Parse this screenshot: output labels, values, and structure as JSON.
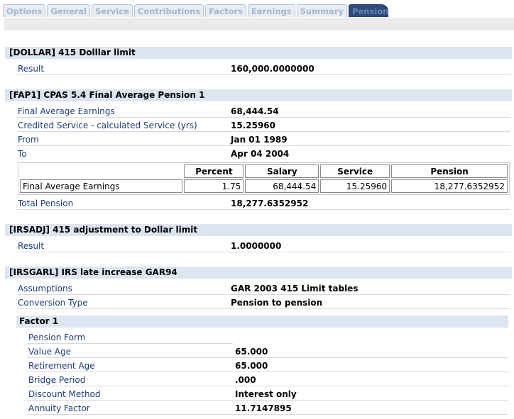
{
  "tabs": [
    {
      "label": "Options"
    },
    {
      "label": "General"
    },
    {
      "label": "Service"
    },
    {
      "label": "Contributions"
    },
    {
      "label": "Factors"
    },
    {
      "label": "Earnings"
    },
    {
      "label": "Summary"
    },
    {
      "label": "Pension",
      "active": true
    }
  ],
  "sections": {
    "dollar": {
      "title": "[DOLLAR] 415 Dolllar limit",
      "rows": [
        {
          "label": "Result",
          "value": "160,000.0000000"
        }
      ]
    },
    "fap1": {
      "title": "[FAP1] CPAS 5.4 Final Average Pension 1",
      "rows": [
        {
          "label": "Final Average Earnings",
          "value": "68,444.54"
        },
        {
          "label": "Credited Service - calculated Service (yrs)",
          "value": "15.25960"
        },
        {
          "label": "From",
          "value": "Jan 01 1989"
        },
        {
          "label": "To",
          "value": "Apr 04 2004"
        }
      ],
      "table": {
        "headers": [
          "Percent",
          "Salary",
          "Service",
          "Pension"
        ],
        "row": {
          "label": "Final Average Earnings",
          "percent": "1.75",
          "salary": "68,444.54",
          "service": "15.25960",
          "pension": "18,277.6352952"
        }
      },
      "total": {
        "label": "Total Pension",
        "value": "18,277.6352952"
      }
    },
    "irsadj": {
      "title": "[IRSADJ] 415 adjustment to Dollar limit",
      "rows": [
        {
          "label": "Result",
          "value": "1.0000000"
        }
      ]
    },
    "irsgarl": {
      "title": "[IRSGARL] IRS late increase GAR94",
      "rows": [
        {
          "label": "Assumptions",
          "value": "GAR 2003 415 Limit tables"
        },
        {
          "label": "Conversion Type",
          "value": "Pension to pension"
        }
      ],
      "factor": {
        "title": "Factor 1",
        "rows": [
          {
            "label": "Pension Form",
            "value": ""
          },
          {
            "label": "Value Age",
            "value": "65.000"
          },
          {
            "label": "Retirement Age",
            "value": "65.000"
          },
          {
            "label": "Bridge Period",
            "value": ".000"
          },
          {
            "label": "Discount Method",
            "value": "Interest only"
          },
          {
            "label": "Annuity Factor",
            "value": "11.7147895"
          }
        ]
      }
    }
  },
  "colors": {
    "section_bg": "#dde5f1",
    "label_text": "#1f3c78",
    "active_tab": "#2c4a7c"
  }
}
